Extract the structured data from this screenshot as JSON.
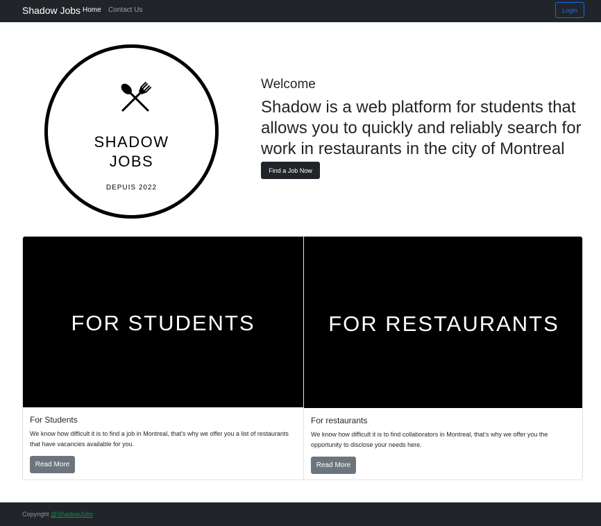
{
  "navbar": {
    "brand": "Shadow Jobs",
    "links": [
      {
        "label": "Home"
      },
      {
        "label": "Contact Us"
      }
    ],
    "login_label": "Login"
  },
  "hero": {
    "logo": {
      "title_line1": "SHADOW",
      "title_line2": "JOBS",
      "subtitle": "DEPUIS 2022",
      "icon": "fork-spoon-icon"
    },
    "heading": "Welcome",
    "lead": "Shadow is a web platform for students that allows you to quickly and reliably search for work in restaurants in the city of Montreal",
    "button_label": "Find a Job Now"
  },
  "cards": [
    {
      "image_text": "FOR STUDENTS",
      "title": "For Students",
      "text": "We know how difficult it is to find a job in Montreal, that's why we offer you a list of restaurants that have vacancies available for you.",
      "button_label": "Read More"
    },
    {
      "image_text": "FOR RESTAURANTS",
      "title": "For restaurants",
      "text": "We know how difficult it is to find collaborators in Montreal, that's why we offer you the opportunity to disclose your needs here.",
      "button_label": "Read More"
    }
  ],
  "footer": {
    "prefix": "Copyright",
    "link": "@ShadowJobs"
  },
  "colors": {
    "dark": "#212529",
    "primary": "#0d6efd",
    "secondary": "#6c757d",
    "footer_link": "#198754"
  }
}
